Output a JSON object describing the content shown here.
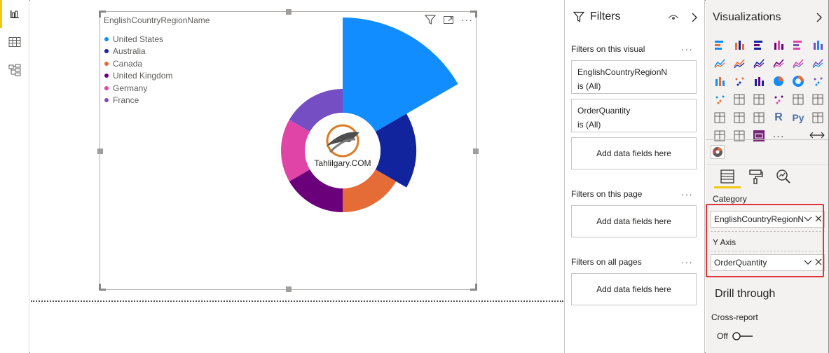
{
  "colors": {
    "accent_yellow": "#f2c811",
    "highlight_red": "#e0353a",
    "series": [
      "#118dff",
      "#12239e",
      "#e66c37",
      "#6b007b",
      "#e044a7",
      "#744ec2"
    ]
  },
  "left_rail": {
    "icons": [
      "report-view-icon",
      "data-view-icon",
      "model-view-icon"
    ]
  },
  "visual": {
    "title": "EnglishCountryRegionName",
    "logo_text": "Tahlilgary.COM",
    "header_icons": [
      "filter-icon",
      "focus-mode-icon",
      "more-options-icon"
    ],
    "more_glyph": "···"
  },
  "chart_data": {
    "type": "pie",
    "subtype": "rose",
    "categories": [
      "United States",
      "Australia",
      "Canada",
      "United Kingdom",
      "Germany",
      "France"
    ],
    "values": [
      27,
      13.5,
      7,
      7,
      6,
      6
    ],
    "legend_position": "top-left",
    "colors": [
      "#118dff",
      "#12239e",
      "#e66c37",
      "#6b007b",
      "#e044a7",
      "#744ec2"
    ]
  },
  "filters": {
    "title": "Filters",
    "on_visual_label": "Filters on this visual",
    "on_page_label": "Filters on this page",
    "on_all_pages_label": "Filters on all pages",
    "ellipsis": "···",
    "cards": [
      {
        "field": "EnglishCountryRegionN",
        "condition": "is (All)"
      },
      {
        "field": "OrderQuantity",
        "condition": "is (All)"
      }
    ],
    "add_label": "Add data fields here"
  },
  "visualizations": {
    "title": "Visualizations",
    "more_glyph": "···",
    "category_label": "Category",
    "category_field": "EnglishCountryRegionN",
    "yaxis_label": "Y Axis",
    "yaxis_field": "OrderQuantity",
    "drill_title": "Drill through",
    "cross_report_label": "Cross-report",
    "toggle_state": "Off",
    "r_glyph": "R",
    "py_glyph": "Py"
  }
}
